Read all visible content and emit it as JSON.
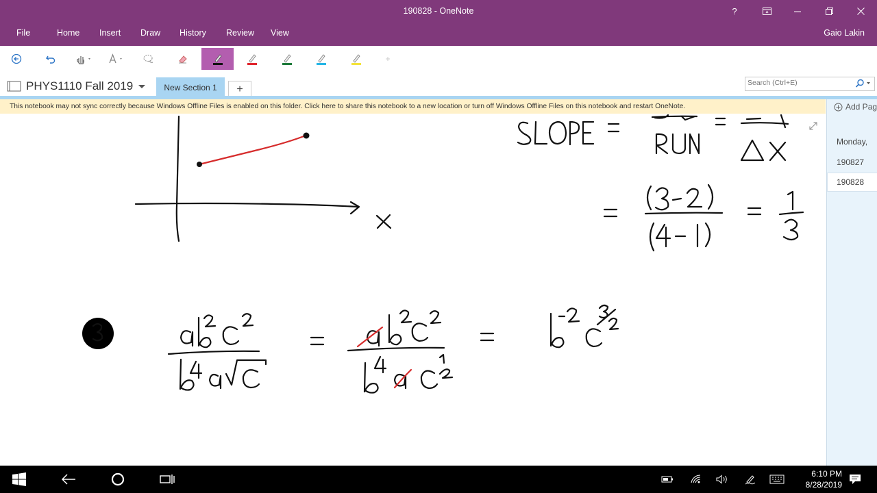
{
  "window": {
    "title": "190828 - OneNote",
    "help": "?",
    "user": "Gaio Lakin"
  },
  "menu": [
    "File",
    "Home",
    "Insert",
    "Draw",
    "History",
    "Review",
    "View"
  ],
  "toolbar": {
    "pens": [
      {
        "color": "#111111",
        "selected": true
      },
      {
        "color": "#e0262e",
        "selected": false
      },
      {
        "color": "#1e7a3a",
        "selected": false
      },
      {
        "color": "#27b6e6",
        "selected": false
      },
      {
        "color": "#f4e33a",
        "selected": false
      }
    ],
    "selected_bg": "#b35eaf"
  },
  "notebook": {
    "name": "PHYS1110 Fall 2019",
    "section_tab": "New Section 1",
    "add_tab": "+"
  },
  "search": {
    "placeholder": "Search (Ctrl+E)"
  },
  "notice": "This notebook may not sync correctly because Windows Offline Files is enabled on this folder. Click here to share this notebook to a new location or turn off Windows Offline Files on this notebook and restart OneNote.",
  "pages": {
    "add_label": "Add Page",
    "items": [
      "Monday,",
      "190827",
      "190828"
    ],
    "selected_index": 2
  },
  "taskbar": {
    "time": "6:10 PM",
    "date": "8/28/2019"
  },
  "colors": {
    "title_bar": "#80397b",
    "section_tab": "#a9d5f2",
    "notice_bg": "#fff1c9",
    "page_pane": "#e8f3fb"
  }
}
